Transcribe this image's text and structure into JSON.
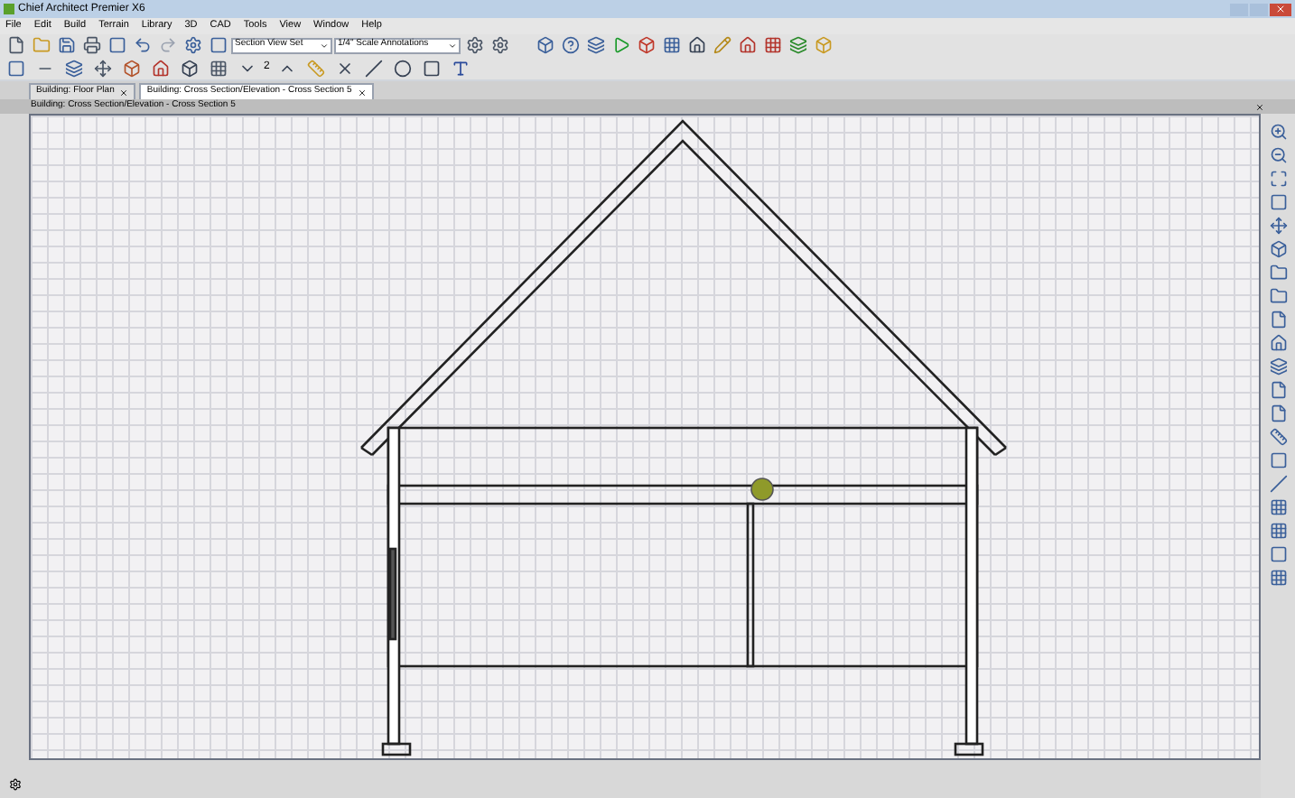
{
  "window": {
    "title": "Chief Architect Premier X6"
  },
  "menu": [
    "File",
    "Edit",
    "Build",
    "Terrain",
    "Library",
    "3D",
    "CAD",
    "Tools",
    "View",
    "Window",
    "Help"
  ],
  "toolbar": {
    "view_set": "Section View Set",
    "annotation_set": "1/4\" Scale Annotations",
    "counter": "2"
  },
  "tabs": [
    {
      "label": "Building: Floor Plan",
      "selected": false
    },
    {
      "label": "Building: Cross Section/Elevation - Cross Section 5",
      "selected": true
    }
  ],
  "view_title": "Building: Cross Section/Elevation - Cross Section 5"
}
